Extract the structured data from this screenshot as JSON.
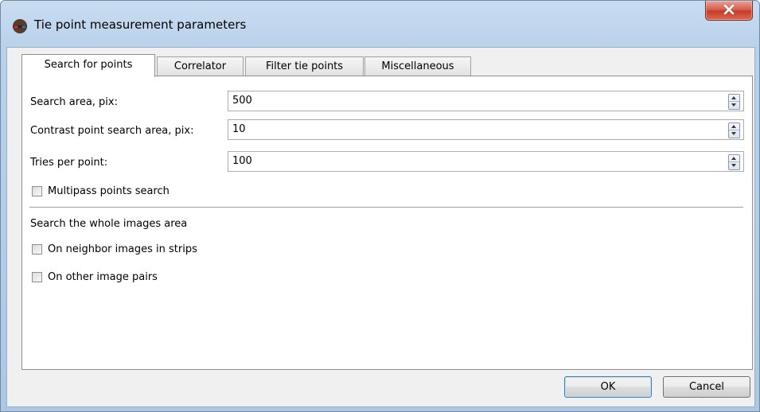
{
  "window": {
    "title": "Tie point measurement parameters",
    "close_glyph": "X"
  },
  "tabs": [
    {
      "label": "Search for points",
      "active": true
    },
    {
      "label": "Correlator",
      "active": false
    },
    {
      "label": "Filter tie points",
      "active": false
    },
    {
      "label": "Miscellaneous",
      "active": false
    }
  ],
  "search_tab": {
    "fields": [
      {
        "label": "Search area, pix:",
        "value": "500"
      },
      {
        "label": "Contrast point search area, pix:",
        "value": "10"
      },
      {
        "label": "Tries per point:",
        "value": "100"
      }
    ],
    "multipass": {
      "label": "Multipass points search",
      "checked": false
    },
    "whole_area": {
      "heading": "Search the whole images area",
      "options": [
        {
          "label": "On neighbor images in strips",
          "checked": false
        },
        {
          "label": "On other image pairs",
          "checked": false
        }
      ]
    }
  },
  "buttons": {
    "ok": "OK",
    "cancel": "Cancel"
  },
  "icons": {
    "app": "stereo-glasses-icon",
    "close": "close-icon",
    "spin_up": "arrow-up-icon",
    "spin_down": "arrow-down-icon"
  },
  "colors": {
    "title_bar": "#b9d1ea",
    "close_button": "#c9503e",
    "dialog_bg": "#f0f0f0",
    "default_button_border": "#3c7fb1"
  }
}
